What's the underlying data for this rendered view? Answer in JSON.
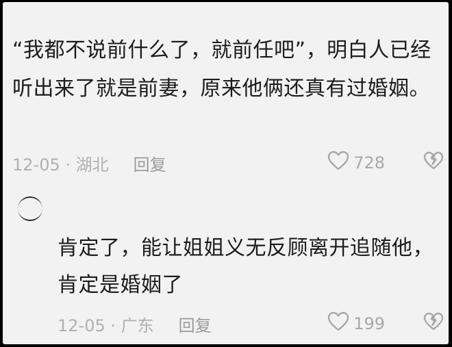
{
  "comment": {
    "text": "“我都不说前什么了，就前任吧”，明白人已经听出来了就是前妻，原来他俩还真有过婚姻。",
    "date_location": "12-05 · 湖北",
    "reply_label": "回复",
    "likes": "728",
    "icons": {
      "like": "heart-outline-icon",
      "dislike": "broken-heart-icon"
    }
  },
  "reply": {
    "text": "肯定了，能让姐姐义无反顾离开追随他，肯定是婚姻了",
    "date_location": "12-05 · 广东",
    "reply_label": "回复",
    "likes": "199"
  },
  "colors": {
    "background": "#f2f2f2",
    "text": "#1c1c1c",
    "meta": "#b0b0b0",
    "frame": "#000000"
  }
}
